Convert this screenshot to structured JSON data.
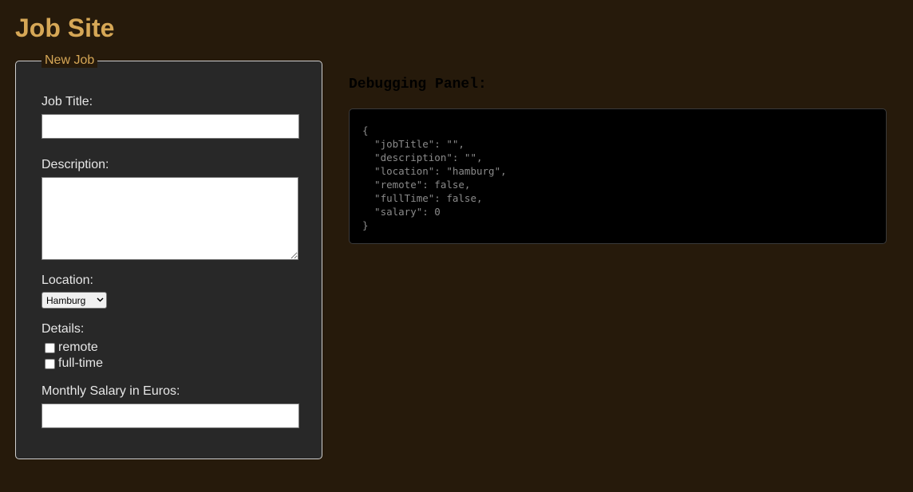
{
  "site": {
    "title": "Job Site"
  },
  "form": {
    "legend": "New Job",
    "job_title": {
      "label": "Job Title:",
      "value": ""
    },
    "description": {
      "label": "Description:",
      "value": ""
    },
    "location": {
      "label": "Location:",
      "selected": "Hamburg"
    },
    "details": {
      "label": "Details:",
      "remote_label": "remote",
      "remote_checked": false,
      "fulltime_label": "full-time",
      "fulltime_checked": false
    },
    "salary": {
      "label": "Monthly Salary in Euros:",
      "value": ""
    }
  },
  "debug": {
    "heading": "Debugging Panel:",
    "json_text": "{\n  \"jobTitle\": \"\",\n  \"description\": \"\",\n  \"location\": \"hamburg\",\n  \"remote\": false,\n  \"fullTime\": false,\n  \"salary\": 0\n}"
  },
  "colors": {
    "background": "#261a0b",
    "accent": "#d6a756",
    "form_bg": "#282828",
    "panel_bg": "#000000"
  }
}
